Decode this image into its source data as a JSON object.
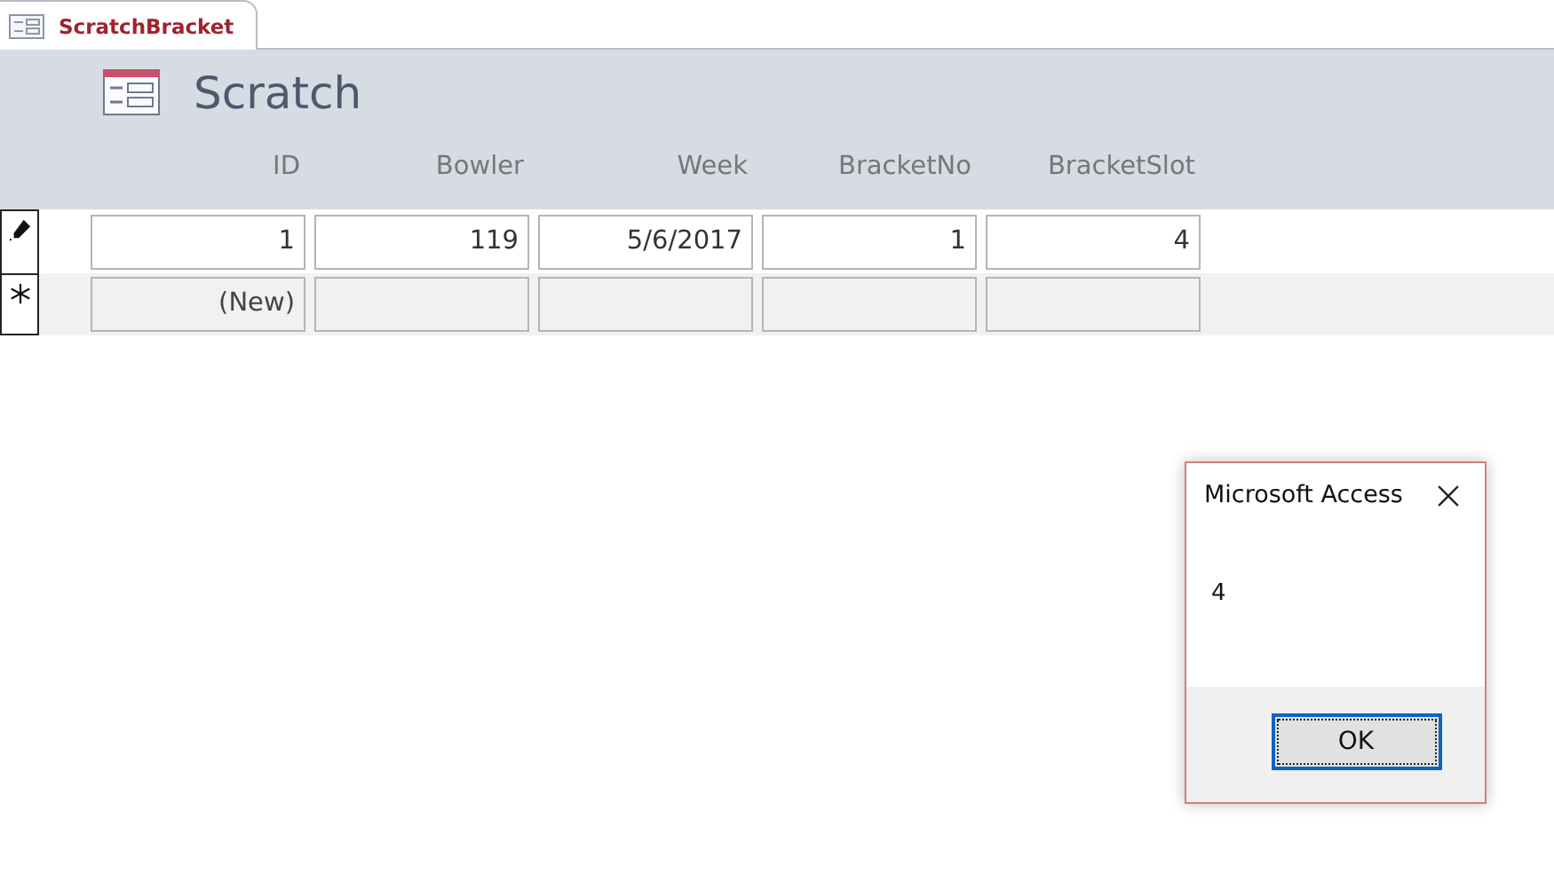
{
  "tab": {
    "label": "ScratchBracket",
    "selected": true
  },
  "form": {
    "title": "Scratch",
    "columns": [
      "ID",
      "Bowler",
      "Week",
      "BracketNo",
      "BracketSlot"
    ],
    "rows": [
      {
        "kind": "editing",
        "cells": [
          "1",
          "119",
          "5/6/2017",
          "1",
          "4"
        ]
      },
      {
        "kind": "new",
        "cells": [
          "(New)"
        ]
      }
    ]
  },
  "dialog": {
    "title": "Microsoft Access",
    "message": "4",
    "buttons": [
      "OK"
    ]
  }
}
